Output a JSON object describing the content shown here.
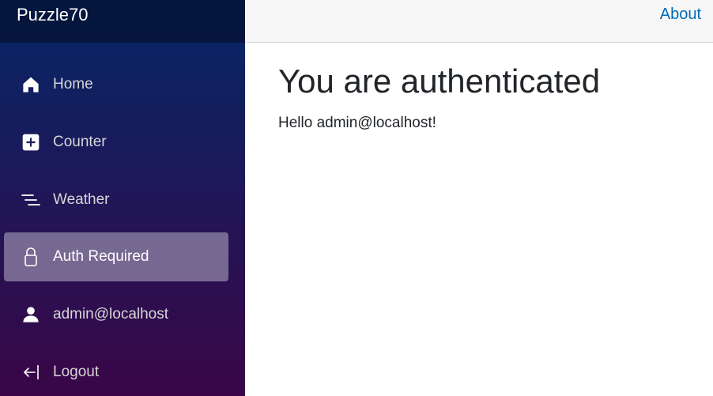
{
  "app": {
    "brand": "Puzzle70"
  },
  "topbar": {
    "about_label": "About"
  },
  "sidebar": {
    "items": [
      {
        "label": "Home",
        "icon": "home-icon",
        "active": false
      },
      {
        "label": "Counter",
        "icon": "plus-square-icon",
        "active": false
      },
      {
        "label": "Weather",
        "icon": "list-icon",
        "active": false
      },
      {
        "label": "Auth Required",
        "icon": "lock-icon",
        "active": true
      },
      {
        "label": "admin@localhost",
        "icon": "person-icon",
        "active": false
      },
      {
        "label": "Logout",
        "icon": "logout-icon",
        "active": false
      }
    ]
  },
  "main": {
    "title": "You are authenticated",
    "greeting": "Hello admin@localhost!"
  },
  "colors": {
    "sidebar_top": "#052767",
    "sidebar_bottom": "#3a0647",
    "link": "#006bb7",
    "text": "#212529",
    "topbar_bg": "#f7f7f7"
  }
}
